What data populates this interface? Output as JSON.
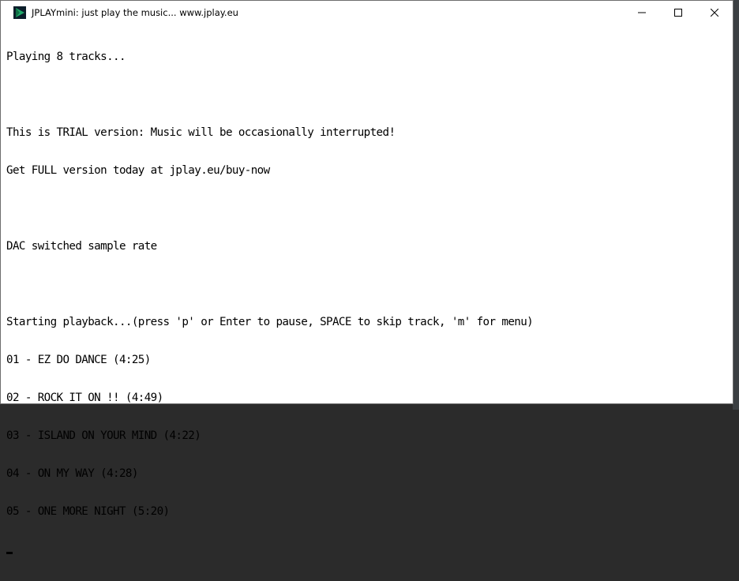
{
  "window": {
    "title": "JPLAYmini: just play the music... www.jplay.eu",
    "icon": "jplay-app-icon"
  },
  "controls": {
    "minimize_icon": "minimize-icon",
    "maximize_icon": "maximize-icon",
    "close_icon": "close-icon"
  },
  "console": {
    "playing": "Playing 8 tracks...",
    "trial_1": "This is TRIAL version: Music will be occasionally interrupted!",
    "trial_2": "Get FULL version today at jplay.eu/buy-now",
    "dac": "DAC switched sample rate",
    "starting": "Starting playback...(press 'p' or Enter to pause, SPACE to skip track, 'm' for menu)",
    "tracks": [
      "01 - EZ DO DANCE (4:25)",
      "02 - ROCK IT ON !! (4:49)",
      "03 - ISLAND ON YOUR MIND (4:22)",
      "04 - ON MY WAY (4:28)",
      "05 - ONE MORE NIGHT (5:20)"
    ]
  },
  "colors": {
    "icon_dark": "#0b1d2a",
    "icon_accent": "#1fa86a"
  }
}
